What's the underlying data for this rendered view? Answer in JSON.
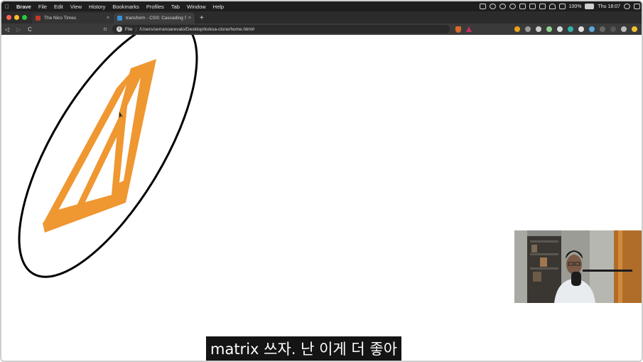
{
  "menubar": {
    "app": "Brave",
    "items": [
      "File",
      "Edit",
      "View",
      "History",
      "Bookmarks",
      "Profiles",
      "Tab",
      "Window",
      "Help"
    ],
    "battery": "100%",
    "clock": "Thu 18:07"
  },
  "tabs": [
    {
      "title": "The Nico Times",
      "close": "×",
      "favicon_color": "#c0392b",
      "active": false
    },
    {
      "title": "transform - CSS: Cascading Styl",
      "close": "×",
      "favicon_color": "#3b8ed8",
      "active": true
    }
  ],
  "new_tab_label": "+",
  "toolbar": {
    "back": "◁",
    "forward": "▷",
    "reload": "C",
    "bookmark": "⌑",
    "info": "i",
    "scheme": "File",
    "separator": "|",
    "url": "/Users/serranoarevalo/Desktop/kokoa-clone/home.html#"
  },
  "extensions": [
    "#e8a317",
    "#9b9b9b",
    "#cfcfcf",
    "#8fd18f",
    "#d9d9d9",
    "#2fb3a8",
    "#e0e0e0",
    "#5aa8e0",
    "#666666",
    "#555555",
    "#bbbbbb",
    "#f2c230"
  ],
  "colors": {
    "shape_fill": "#EF9731",
    "ellipse_stroke": "#000000",
    "menubar_bg": "#1e1e1e",
    "toolbar_bg": "#3a3a3a"
  },
  "subtitle": "matrix 쓰자. 난 이게 더 좋아"
}
